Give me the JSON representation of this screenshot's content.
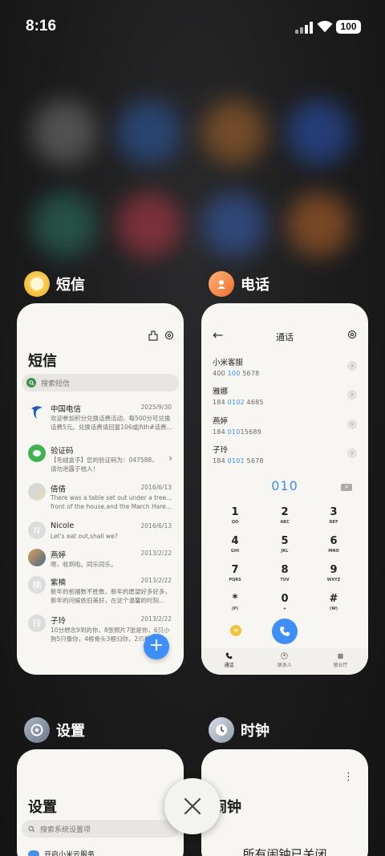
{
  "status": {
    "time": "8:16",
    "battery": "100"
  },
  "apps": {
    "sms": {
      "name": "短信",
      "title": "短信",
      "search_placeholder": "搜索短信",
      "fab": "+",
      "messages": [
        {
          "name": "中国电信",
          "date": "2025/9/30",
          "line1": "欢迎参加积分兑换话费活动，每500分可兑换",
          "line2": "话费5元。兑换话费请回复106或jfdh#话费..."
        },
        {
          "name": "验证码",
          "date": "",
          "line1": "【毛绒盒子】您的验证码为：047588，",
          "line2": "请勿泄露于他人！"
        },
        {
          "name": "倩倩",
          "date": "2016/6/13",
          "line1": "There was a table set out under a tree in",
          "line2": "front of the house,and the March Hare an..."
        },
        {
          "name": "Nicole",
          "date": "2016/6/13",
          "line1": "Let's eat out,shall we?",
          "line2": ""
        },
        {
          "name": "燕婷",
          "date": "2013/2/22",
          "line1": "嗯，收到啦。同乐同乐。",
          "line2": ""
        },
        {
          "name": "紫楠",
          "date": "2013/2/22",
          "line1": "新年的祝福数不胜数，新年的愿望好多好多，",
          "line2": "新年的问候依旧美好，在这个温馨的时刻..."
        },
        {
          "name": "子玲",
          "date": "2013/2/22",
          "line1": "10分想念9到的你，8张照片7张是你，6只小",
          "line2": "狗5只像你，4根骨头3根归你，2爪看你1..."
        }
      ],
      "avatar_letters": {
        "nicole": "N",
        "zinan": "楠",
        "ziling": "玲"
      }
    },
    "phone": {
      "name": "电话",
      "title": "通话",
      "dialed": "010",
      "contacts": [
        {
          "name": "小米客服",
          "num_pre": "400 ",
          "num_hi": "100",
          "num_post": " 5678"
        },
        {
          "name": "雅娜",
          "num_pre": "184 ",
          "num_hi": "0102",
          "num_post": " 4685"
        },
        {
          "name": "燕婷",
          "num_pre": "184 ",
          "num_hi": "010",
          "num_post": "15689"
        },
        {
          "name": "子玲",
          "num_pre": "184 ",
          "num_hi": "0101",
          "num_post": " 5678"
        }
      ],
      "keys": [
        {
          "d": "1",
          "l": "QO"
        },
        {
          "d": "2",
          "l": "ABC"
        },
        {
          "d": "3",
          "l": "DEF"
        },
        {
          "d": "4",
          "l": "GHI"
        },
        {
          "d": "5",
          "l": "JKL"
        },
        {
          "d": "6",
          "l": "MNO"
        },
        {
          "d": "7",
          "l": "PQRS"
        },
        {
          "d": "8",
          "l": "TUV"
        },
        {
          "d": "9",
          "l": "WXYZ"
        },
        {
          "d": "*",
          "l": "(P)"
        },
        {
          "d": "0",
          "l": "+"
        },
        {
          "d": "#",
          "l": "(W)"
        }
      ],
      "nav": [
        "通话",
        "联系人",
        "营业厅"
      ]
    },
    "settings": {
      "name": "设置",
      "title": "设置",
      "search_placeholder": "搜索系统设置项",
      "first_item": "开启小米云服务"
    },
    "clock": {
      "name": "时钟",
      "title": "闹钟",
      "message": "所有闹钟已关闭"
    }
  },
  "colors": {
    "accent": "#3e8ef7",
    "card": "#f7f6f2"
  }
}
